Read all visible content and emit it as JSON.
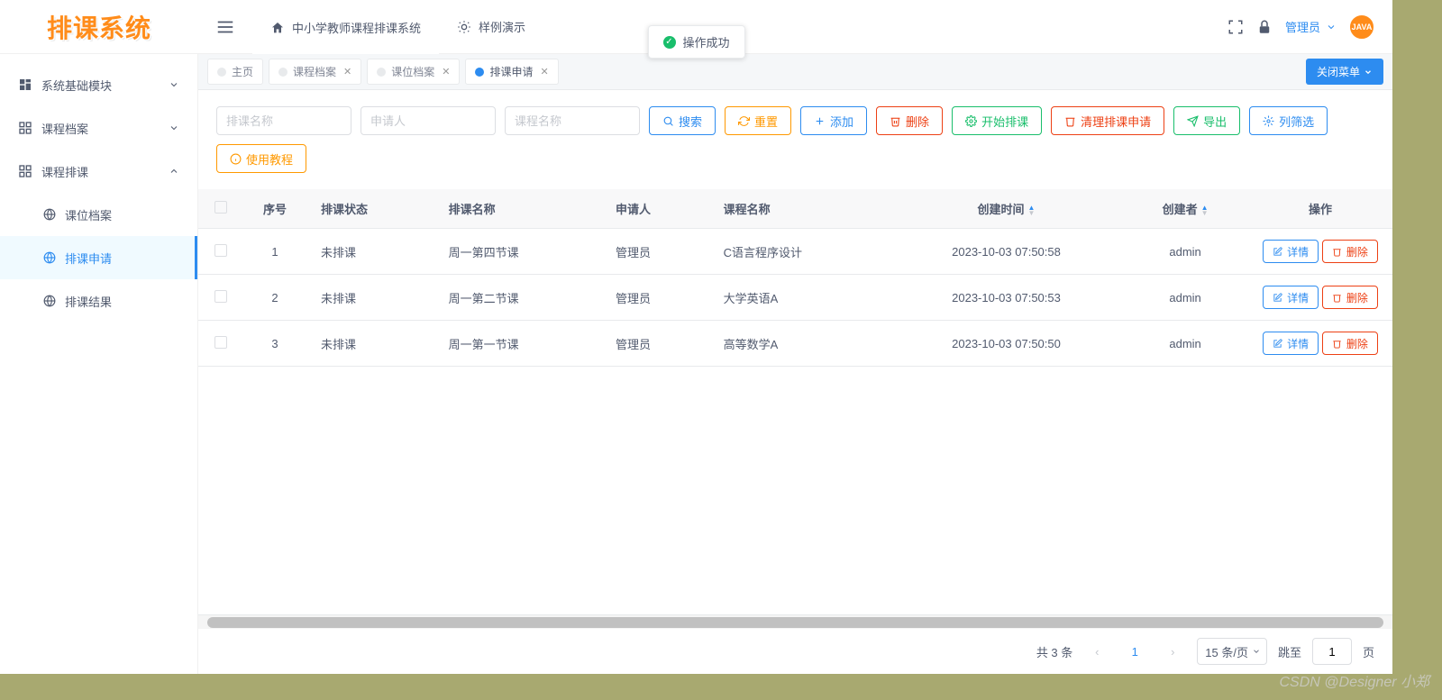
{
  "logo": "排课系统",
  "header": {
    "system_title": "中小学教师课程排课系统",
    "demo_label": "样例演示",
    "user_label": "管理员",
    "avatar_text": "JAVA"
  },
  "toast": {
    "text": "操作成功"
  },
  "sidebar": {
    "items": [
      {
        "label": "系统基础模块",
        "icon": "dashboard-icon",
        "expand": "down"
      },
      {
        "label": "课程档案",
        "icon": "grid-icon",
        "expand": "down"
      },
      {
        "label": "课程排课",
        "icon": "grid-icon",
        "expand": "up"
      }
    ],
    "sub_items": [
      {
        "label": "课位档案"
      },
      {
        "label": "排课申请"
      },
      {
        "label": "排课结果"
      }
    ]
  },
  "tabs": [
    {
      "label": "主页",
      "closable": false
    },
    {
      "label": "课程档案",
      "closable": true
    },
    {
      "label": "课位档案",
      "closable": true
    },
    {
      "label": "排课申请",
      "closable": true
    }
  ],
  "close_menu_label": "关闭菜单",
  "search": {
    "name_ph": "排课名称",
    "applicant_ph": "申请人",
    "course_ph": "课程名称"
  },
  "buttons": {
    "search": "搜索",
    "reset": "重置",
    "add": "添加",
    "delete": "删除",
    "start": "开始排课",
    "clear": "清理排课申请",
    "export": "导出",
    "columns": "列筛选",
    "tutorial": "使用教程"
  },
  "table": {
    "headers": {
      "index": "序号",
      "status": "排课状态",
      "name": "排课名称",
      "applicant": "申请人",
      "course": "课程名称",
      "created_at": "创建时间",
      "creator": "创建者",
      "actions": "操作"
    },
    "rows": [
      {
        "index": "1",
        "status": "未排课",
        "name": "周一第四节课",
        "applicant": "管理员",
        "course": "C语言程序设计",
        "created_at": "2023-10-03 07:50:58",
        "creator": "admin"
      },
      {
        "index": "2",
        "status": "未排课",
        "name": "周一第二节课",
        "applicant": "管理员",
        "course": "大学英语A",
        "created_at": "2023-10-03 07:50:53",
        "creator": "admin"
      },
      {
        "index": "3",
        "status": "未排课",
        "name": "周一第一节课",
        "applicant": "管理员",
        "course": "高等数学A",
        "created_at": "2023-10-03 07:50:50",
        "creator": "admin"
      }
    ],
    "row_buttons": {
      "detail": "详情",
      "delete": "删除"
    }
  },
  "pagination": {
    "total_text": "共 3 条",
    "page": "1",
    "size_label": "15 条/页",
    "jump_label": "跳至",
    "jump_value": "1",
    "page_suffix": "页"
  },
  "watermark": "CSDN @Designer 小郑"
}
